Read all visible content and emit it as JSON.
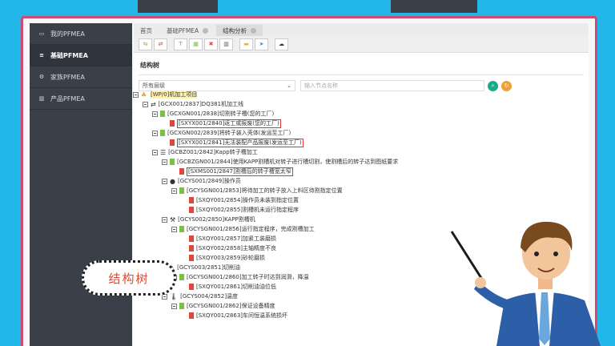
{
  "sidebar": {
    "items": [
      {
        "label": "我的PFMEA",
        "icon": "monitor-icon"
      },
      {
        "label": "基础PFMEA",
        "icon": "list-icon"
      },
      {
        "label": "家族PFMEA",
        "icon": "gear-icon"
      },
      {
        "label": "产品PFMEA",
        "icon": "chart-icon"
      }
    ]
  },
  "tabs": [
    {
      "label": "首页"
    },
    {
      "label": "基础PFMEA"
    },
    {
      "label": "结构分析"
    }
  ],
  "main": {
    "section_title": "结构树",
    "level_select": "所有层级",
    "search_placeholder": "输入节点名称"
  },
  "tree": [
    {
      "text": "[WP/0]机加工项目",
      "level": 0,
      "icon": "tree-icon"
    },
    {
      "text": "[GCX001/2837]DQ381机加工线",
      "level": 1,
      "icon": "line-icon"
    },
    {
      "text": "[GCXGN001/2838]切割转子槽(您的工厂)",
      "level": 2,
      "icon": "green-square"
    },
    {
      "text": "[SXYX001/2840]返工或报废(您的工厂)",
      "level": 3,
      "icon": "red-square"
    },
    {
      "text": "[GCXGN002/2839]将转子装入壳体(发运至工厂)",
      "level": 2,
      "icon": "green-square"
    },
    {
      "text": "[SXYX001/2841]无法装配产品报废(发运至工厂)",
      "level": 3,
      "icon": "red-square"
    },
    {
      "text": "[GCBZ001/2842]Kapp转子槽加工",
      "level": 2,
      "icon": "list-icon"
    },
    {
      "text": "[GCBZGN001/2844]使用KAPP割槽机对转子进行槽切割，使割槽后的转子达到图纸要求",
      "level": 3,
      "icon": "green-square"
    },
    {
      "text": "[SXMS001/2847]割槽后的转子槽宽太窄",
      "level": 4,
      "icon": "red-square"
    },
    {
      "text": "[GCYS001/2849]操作员",
      "level": 3,
      "icon": "person-icon"
    },
    {
      "text": "[GCYSGN001/2853]将待加工的转子放入上料区待割指定位置",
      "level": 4,
      "icon": "green-square"
    },
    {
      "text": "[SXQY001/2854]操作员未装到指定位置",
      "level": 5,
      "icon": "red-square"
    },
    {
      "text": "[SXQY002/2855]割槽机未运行指定程序",
      "level": 5,
      "icon": "red-square"
    },
    {
      "text": "[GCYS002/2850]KAPP割槽机",
      "level": 3,
      "icon": "machine-icon"
    },
    {
      "text": "[GCYSGN001/2856]运行指定程序，完成割槽加工",
      "level": 4,
      "icon": "green-square"
    },
    {
      "text": "[SXQY001/2857]加紧工装磨损",
      "level": 5,
      "icon": "red-square"
    },
    {
      "text": "[SXQY002/2858]主轴精度不良",
      "level": 5,
      "icon": "red-square"
    },
    {
      "text": "[SXQY003/2859]砂轮磨损",
      "level": 5,
      "icon": "red-square"
    },
    {
      "text": "[GCYS003/2851]切削油",
      "level": 3,
      "icon": "oil-icon"
    },
    {
      "text": "[GCYSGN001/2860]加工转子时达到润滑，降温",
      "level": 4,
      "icon": "green-square"
    },
    {
      "text": "[SXQY001/2861]切削油油位低",
      "level": 5,
      "icon": "red-square"
    },
    {
      "text": "[GCYS004/2852]温度",
      "level": 3,
      "icon": "thermometer-icon"
    },
    {
      "text": "[GCYSGN001/2862]保证设备精度",
      "level": 4,
      "icon": "green-square"
    },
    {
      "text": "[SXQY001/2863]车间恒温系统损坏",
      "level": 5,
      "icon": "red-square"
    }
  ],
  "callout": {
    "text": "结构树"
  },
  "colors": {
    "bg": "#23b6e8",
    "frame": "#d04a73",
    "sidebar": "#3a3f4a",
    "green": "#7bc043",
    "red": "#e0473c",
    "callout_text": "#e04830"
  }
}
